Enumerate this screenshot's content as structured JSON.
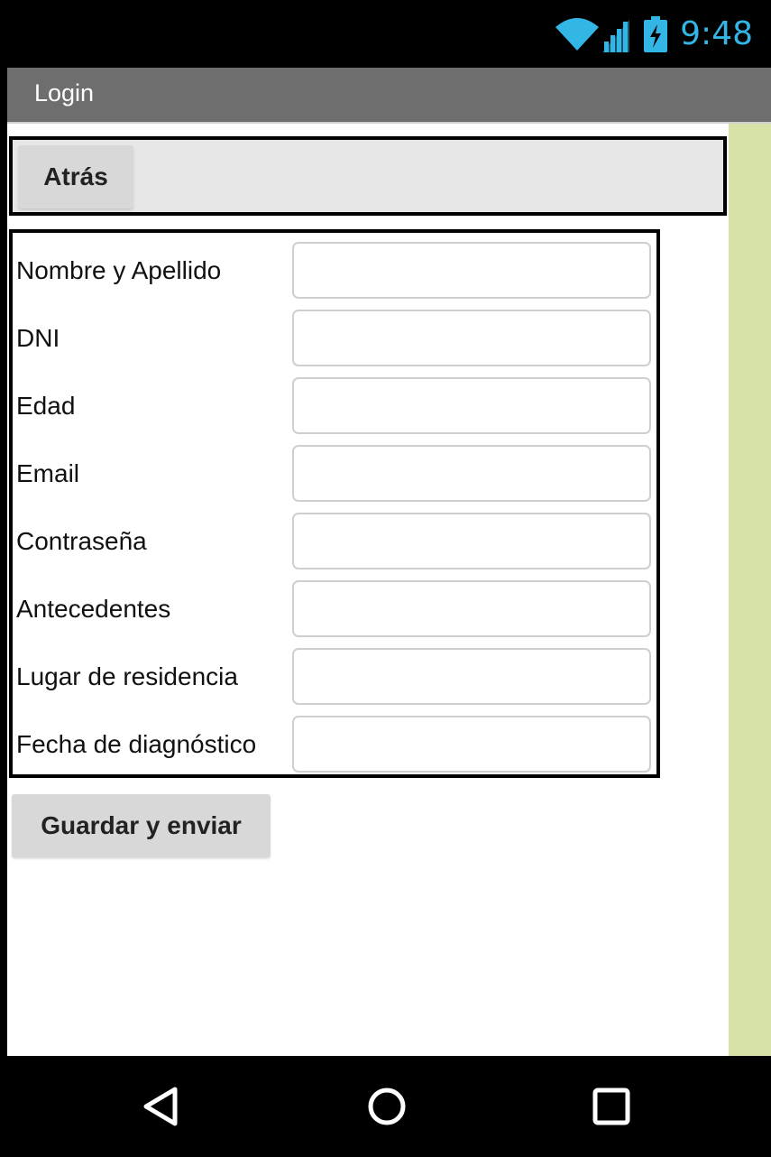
{
  "status_bar": {
    "time": "9:48",
    "icons": [
      "wifi-icon",
      "signal-icon",
      "battery-charging-icon"
    ],
    "accent_color": "#33b5e5"
  },
  "action_bar": {
    "title": "Login"
  },
  "back_button": {
    "label": "Atrás"
  },
  "form": {
    "fields": [
      {
        "label": "Nombre y Apellido",
        "value": ""
      },
      {
        "label": "DNI",
        "value": ""
      },
      {
        "label": "Edad",
        "value": ""
      },
      {
        "label": "Email",
        "value": ""
      },
      {
        "label": "Contraseña",
        "value": ""
      },
      {
        "label": "Antecedentes",
        "value": ""
      },
      {
        "label": "Lugar de residencia",
        "value": ""
      },
      {
        "label": "Fecha de diagnóstico",
        "value": ""
      }
    ]
  },
  "save_button": {
    "label": "Guardar y enviar"
  },
  "nav_bar": {
    "icons": [
      "back-triangle-icon",
      "home-circle-icon",
      "recents-square-icon"
    ]
  }
}
